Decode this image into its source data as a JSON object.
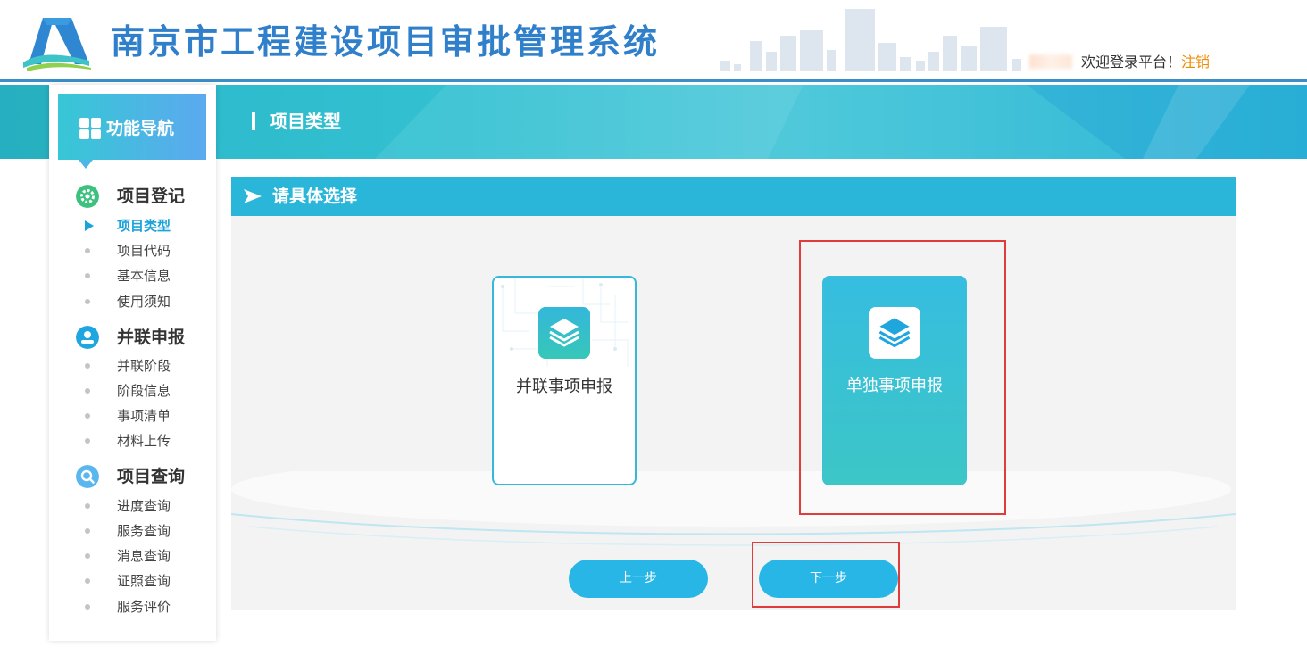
{
  "header": {
    "system_title": "南京市工程建设项目审批管理系统",
    "welcome_text": "欢迎登录平台！",
    "logout_label": "注销"
  },
  "banner": {
    "page_heading": "项目类型"
  },
  "sidebar": {
    "nav_title": "功能导航",
    "groups": [
      {
        "title": "项目登记",
        "icon": "gear-icon",
        "icon_color": "#3cc17f",
        "items": [
          "项目类型",
          "项目代码",
          "基本信息",
          "使用须知"
        ],
        "active_index": 0
      },
      {
        "title": "并联申报",
        "icon": "user-icon",
        "icon_color": "#1fa6e0",
        "items": [
          "并联阶段",
          "阶段信息",
          "事项清单",
          "材料上传"
        ]
      },
      {
        "title": "项目查询",
        "icon": "search-icon",
        "icon_color": "#59b6ef",
        "items": [
          "进度查询",
          "服务查询",
          "消息查询",
          "证照查询",
          "服务评价"
        ]
      }
    ]
  },
  "main": {
    "select_title": "请具体选择",
    "cards": [
      {
        "label": "并联事项申报",
        "icon": "layers-icon",
        "selected": false
      },
      {
        "label": "单独事项申报",
        "icon": "layers-icon",
        "selected": true
      }
    ],
    "prev_label": "上一步",
    "next_label": "下一步"
  },
  "colors": {
    "accent": "#29b6d9",
    "title_blue": "#2f7fcb",
    "logout_orange": "#f08a00",
    "highlight_red": "#e03c3c"
  }
}
